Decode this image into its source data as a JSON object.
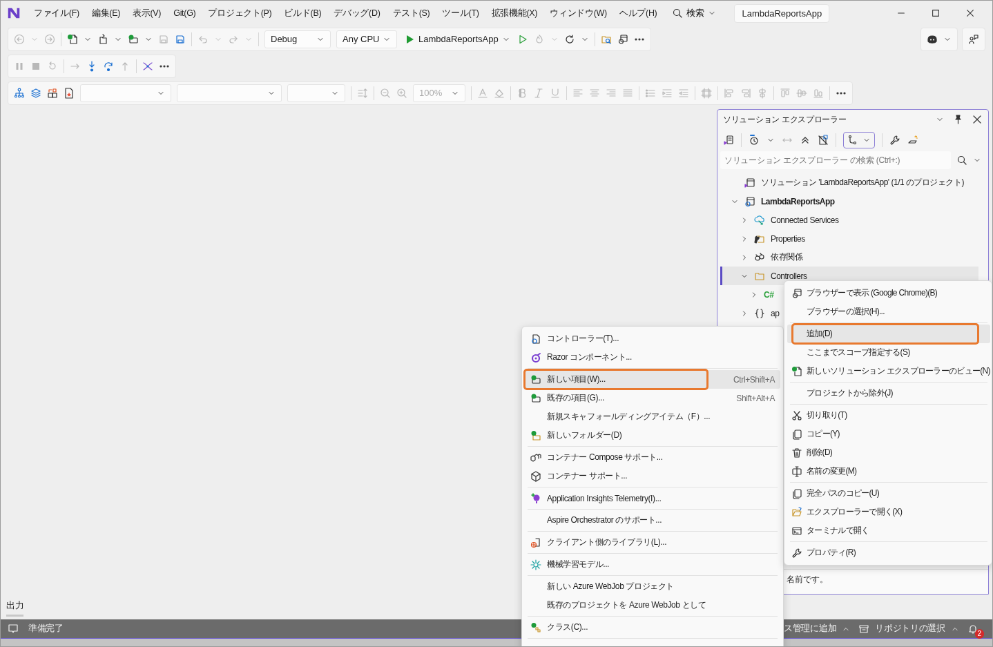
{
  "menu_bar": [
    "ファイル(F)",
    "編集(E)",
    "表示(V)",
    "Git(G)",
    "プロジェクト(P)",
    "ビルド(B)",
    "デバッグ(D)",
    "テスト(S)",
    "ツール(T)",
    "拡張機能(X)",
    "ウィンドウ(W)",
    "ヘルプ(H)"
  ],
  "search": {
    "label": "検索"
  },
  "window": {
    "title": "LambdaReportsApp"
  },
  "standard_toolbar": {
    "configuration": "Debug",
    "platform": "Any CPU",
    "startup": "LambdaReportsApp"
  },
  "format_toolbar": {
    "zoom": "100%"
  },
  "solution_explorer": {
    "title": "ソリューション エクスプローラー",
    "search": {
      "placeholder": "ソリューション エクスプローラー の検索 (Ctrl+:)"
    },
    "tree": [
      {
        "kind": "solution",
        "label": "ソリューション 'LambdaReportsApp' (1/1 のプロジェクト)",
        "selected": false
      },
      {
        "kind": "project",
        "label": "LambdaReportsApp",
        "expanded": true,
        "selected": false,
        "children": [
          {
            "kind": "connected",
            "label": "Connected Services",
            "expanded": false,
            "selected": false
          },
          {
            "kind": "properties",
            "label": "Properties",
            "expanded": false,
            "selected": false
          },
          {
            "kind": "dependencies",
            "label": "依存関係",
            "expanded": false,
            "selected": false
          },
          {
            "kind": "folder",
            "label": "Controllers",
            "expanded": true,
            "selected": true,
            "children": [
              {
                "kind": "csharp",
                "icon_text": "C#",
                "expanded": false,
                "selected": false
              }
            ]
          },
          {
            "kind": "json",
            "label": "ap",
            "expanded": false,
            "selected": false
          }
        ]
      }
    ],
    "description": "名前です。"
  },
  "output_tab": {
    "label": "出力"
  },
  "add_submenu": [
    {
      "kind": "item",
      "label": "コントローラー(T)...",
      "selected": false
    },
    {
      "kind": "item",
      "label": "Razor コンポーネント...",
      "selected": false
    },
    {
      "kind": "separator"
    },
    {
      "kind": "item",
      "label": "新しい項目(W)...",
      "shortcut": "Ctrl+Shift+A",
      "selected": true
    },
    {
      "kind": "item",
      "label": "既存の項目(G)...",
      "shortcut": "Shift+Alt+A",
      "selected": false
    },
    {
      "kind": "item",
      "label": "新規スキャフォールディングアイテム（F）...",
      "selected": false
    },
    {
      "kind": "item",
      "label": "新しいフォルダー(D)",
      "selected": false
    },
    {
      "kind": "separator"
    },
    {
      "kind": "item",
      "label": "コンテナー Compose サポート...",
      "selected": false
    },
    {
      "kind": "item",
      "label": "コンテナー サポート...",
      "selected": false
    },
    {
      "kind": "separator"
    },
    {
      "kind": "item",
      "label": "Application Insights Telemetry(I)...",
      "selected": false
    },
    {
      "kind": "separator"
    },
    {
      "kind": "item",
      "label": "Aspire Orchestrator のサポート...",
      "selected": false
    },
    {
      "kind": "separator"
    },
    {
      "kind": "item",
      "label": "クライアント側のライブラリ(L)...",
      "selected": false
    },
    {
      "kind": "separator"
    },
    {
      "kind": "item",
      "label": "機械学習モデル...",
      "selected": false
    },
    {
      "kind": "separator"
    },
    {
      "kind": "item",
      "label": "新しい Azure WebJob プロジェクト",
      "selected": false
    },
    {
      "kind": "item",
      "label": "既存のプロジェクトを Azure WebJob として",
      "selected": false
    },
    {
      "kind": "separator"
    },
    {
      "kind": "item",
      "label": "クラス(C)...",
      "selected": false
    },
    {
      "kind": "separator"
    }
  ],
  "context_menu": [
    {
      "kind": "item",
      "label": "ブラウザーで表示 (Google Chrome)(B)",
      "selected": false
    },
    {
      "kind": "item",
      "label": "ブラウザーの選択(H)...",
      "selected": false
    },
    {
      "kind": "separator"
    },
    {
      "kind": "item",
      "label": "追加(D)",
      "selected": true
    },
    {
      "kind": "item",
      "label": "ここまでスコープ指定する(S)",
      "selected": false
    },
    {
      "kind": "item",
      "label": "新しいソリューション エクスプローラーのビュー(N)",
      "selected": false
    },
    {
      "kind": "separator"
    },
    {
      "kind": "item",
      "label": "プロジェクトから除外(J)",
      "selected": false
    },
    {
      "kind": "separator"
    },
    {
      "kind": "item",
      "label": "切り取り(T)",
      "selected": false
    },
    {
      "kind": "item",
      "label": "コピー(Y)",
      "selected": false
    },
    {
      "kind": "item",
      "label": "削除(D)",
      "selected": false
    },
    {
      "kind": "item",
      "label": "名前の変更(M)",
      "selected": false
    },
    {
      "kind": "separator"
    },
    {
      "kind": "item",
      "label": "完全パスのコピー(U)",
      "selected": false
    },
    {
      "kind": "item",
      "label": "エクスプローラーで開く(X)",
      "selected": false
    },
    {
      "kind": "item",
      "label": "ターミナルで開く",
      "selected": false
    },
    {
      "kind": "separator"
    },
    {
      "kind": "item",
      "label": "プロパティ(R)",
      "selected": false
    }
  ],
  "status_bar": {
    "message": "準備完了",
    "source_control": "ス管理に追加",
    "repository": "リポジトリの選択",
    "notifications": "2"
  }
}
